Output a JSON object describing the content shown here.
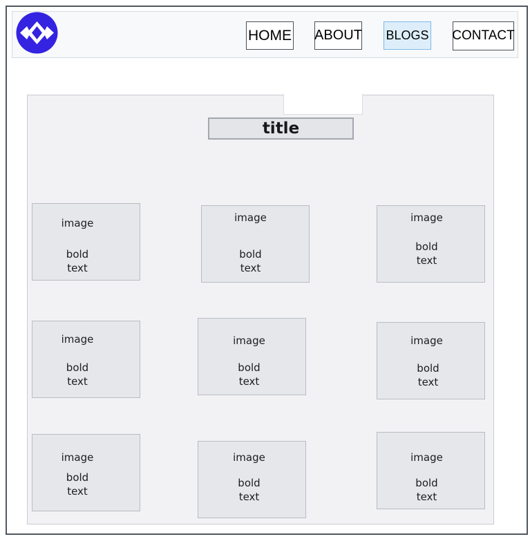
{
  "header": {
    "logo_icon": "diamond-arrows-logo-icon",
    "brand_color": "#3423e0",
    "nav": {
      "home": "HOME",
      "about": "ABOUT",
      "blogs": "BLOGS",
      "contact": "CONTACT"
    },
    "active_nav": "BLOGS"
  },
  "main": {
    "title": "title",
    "cards": [
      {
        "image": "image",
        "line1": "bold",
        "line2": "text"
      },
      {
        "image": "image",
        "line1": "bold",
        "line2": "text"
      },
      {
        "image": "image",
        "line1": "bold",
        "line2": "text"
      },
      {
        "image": "image",
        "line1": "bold",
        "line2": "text"
      },
      {
        "image": "image",
        "line1": "bold",
        "line2": "text"
      },
      {
        "image": "image",
        "line1": "bold",
        "line2": "text"
      },
      {
        "image": "image",
        "line1": "bold",
        "line2": "text"
      },
      {
        "image": "image",
        "line1": "bold",
        "line2": "text"
      },
      {
        "image": "image",
        "line1": "bold",
        "line2": "text"
      }
    ]
  }
}
